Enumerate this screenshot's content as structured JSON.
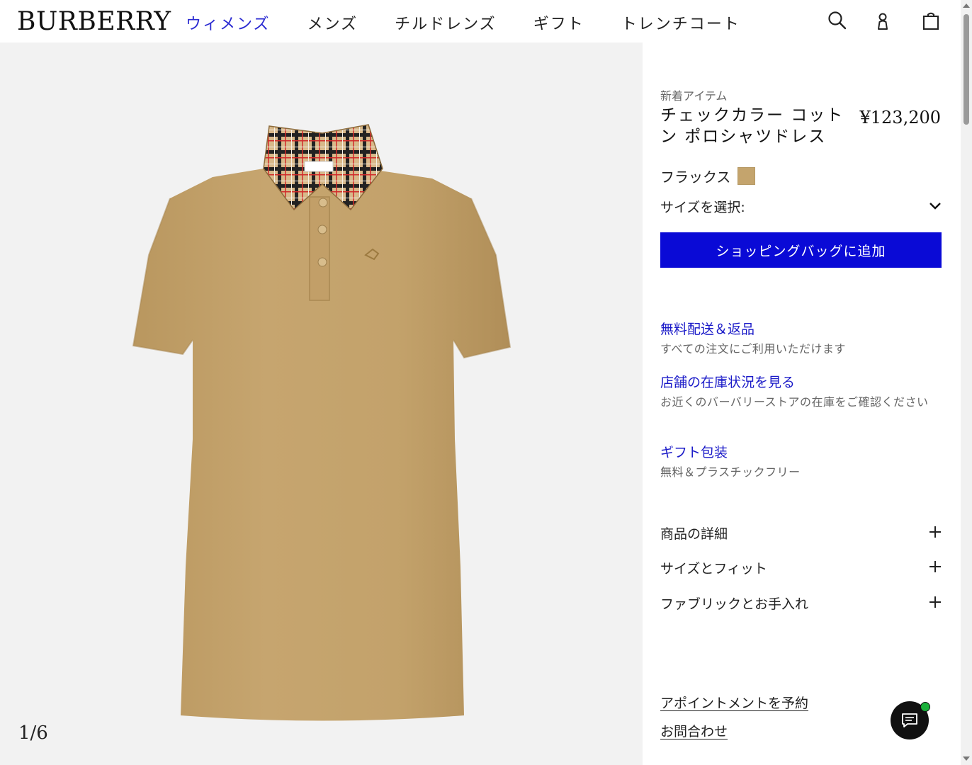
{
  "brand": "BURBERRY",
  "nav": {
    "items": [
      {
        "label": "ウィメンズ",
        "active": true
      },
      {
        "label": "メンズ",
        "active": false
      },
      {
        "label": "チルドレンズ",
        "active": false
      },
      {
        "label": "ギフト",
        "active": false
      },
      {
        "label": "トレンチコート",
        "active": false
      }
    ],
    "icons": [
      "search-icon",
      "account-icon",
      "bag-icon"
    ]
  },
  "gallery": {
    "counter": "1/6",
    "image_description": "Beige pique polo dress with check collar",
    "label_tag": "BURBERRY"
  },
  "product": {
    "eyebrow": "新着アイテム",
    "title": "チェックカラー コットン ポロシャツドレス",
    "price": "¥123,200",
    "color_label": "フラックス",
    "color_hex": "#c4a46d",
    "size_label": "サイズを選択:",
    "add_to_bag": "ショッピングバッグに追加"
  },
  "services": [
    {
      "title": "無料配送＆返品",
      "desc": "すべての注文にご利用いただけます"
    },
    {
      "title": "店舗の在庫状況を見る",
      "desc": "お近くのバーバリーストアの在庫をご確認ください"
    },
    {
      "title": "ギフト包装",
      "desc": "無料＆プラスチックフリー"
    }
  ],
  "accordions": [
    {
      "label": "商品の詳細"
    },
    {
      "label": "サイズとフィット"
    },
    {
      "label": "ファブリックとお手入れ"
    }
  ],
  "bottom_links": {
    "appointment": "アポイントメントを予約",
    "contact": "お問合わせ"
  },
  "colors": {
    "accent": "#0a0ad6",
    "link": "#1a1ac8",
    "nav_active": "#2a2ad1",
    "chat_status": "#19b13a"
  }
}
